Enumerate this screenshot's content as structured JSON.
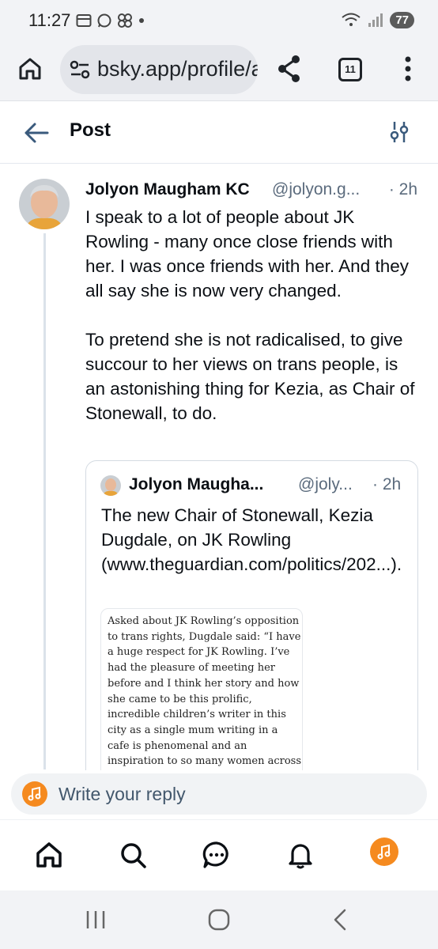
{
  "status_bar": {
    "time": "11:27",
    "battery": "77",
    "notification_icons": [
      "calendar-icon",
      "whatsapp-icon",
      "pinwheel-icon",
      "dot-icon"
    ],
    "system_icons": [
      "wifi-icon",
      "signal-icon",
      "battery-icon"
    ]
  },
  "browser": {
    "url": "bsky.app/profile/a",
    "tab_count": "11"
  },
  "header": {
    "title": "Post"
  },
  "post": {
    "author": "Jolyon Maugham KC",
    "handle": "@jolyon.g...",
    "time": "· 2h",
    "text": "I speak to a lot of people about JK Rowling - many once close friends with her. I was once friends with her. And they all say she is now very changed.\n\nTo pretend she is not radicalised, to give succour to her views on trans people, is an astonishing thing for Kezia, as Chair of Stonewall, to do."
  },
  "quote": {
    "author": "Jolyon Maugha...",
    "handle": "@joly...",
    "time": "· 2h",
    "text": "The new Chair of Stonewall, Kezia Dugdale, on JK Rowling (www.theguardian.com/politics/202...).",
    "image_text": "Asked about JK Rowling’s opposition to trans rights, Dugdale said: “I have a huge respect for JK Rowling. I’ve had the pleasure of meeting her before and I think her story and how she came to be this prolific, incredible children’s writer in this city as a single mum writing in a cafe is phenomenal and an inspiration to so many women across the world"
  },
  "reply": {
    "placeholder": "Write your reply"
  },
  "colors": {
    "accent_orange": "#f58a1f",
    "link_blue": "#1083fe",
    "muted_text": "#5b6b7d"
  }
}
